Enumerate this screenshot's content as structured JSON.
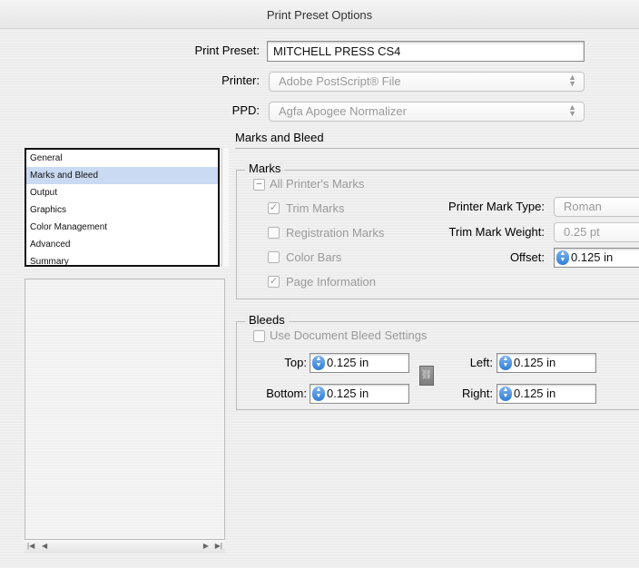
{
  "window": {
    "title": "Print Preset Options"
  },
  "form": {
    "print_preset_label": "Print Preset:",
    "print_preset_value": "MITCHELL PRESS CS4",
    "printer_label": "Printer:",
    "printer_value": "Adobe PostScript® File",
    "ppd_label": "PPD:",
    "ppd_value": "Agfa Apogee Normalizer"
  },
  "sidebar": {
    "items": [
      {
        "label": "General",
        "selected": false
      },
      {
        "label": "Marks and Bleed",
        "selected": true
      },
      {
        "label": "Output",
        "selected": false
      },
      {
        "label": "Graphics",
        "selected": false
      },
      {
        "label": "Color Management",
        "selected": false
      },
      {
        "label": "Advanced",
        "selected": false
      },
      {
        "label": "Summary",
        "selected": false
      }
    ]
  },
  "panel": {
    "title": "Marks and Bleed",
    "marks": {
      "group_title": "Marks",
      "all_marks_label": "All Printer's Marks",
      "all_marks_state": "mixed",
      "trim_marks_label": "Trim Marks",
      "trim_marks_checked": true,
      "registration_marks_label": "Registration Marks",
      "registration_marks_checked": false,
      "color_bars_label": "Color Bars",
      "color_bars_checked": false,
      "page_info_label": "Page Information",
      "page_info_checked": true,
      "mark_type_label": "Printer Mark Type:",
      "mark_type_value": "Roman",
      "trim_weight_label": "Trim Mark Weight:",
      "trim_weight_value": "0.25 pt",
      "offset_label": "Offset:",
      "offset_value": "0.125 in"
    },
    "bleeds": {
      "group_title": "Bleeds",
      "use_doc_label": "Use Document Bleed Settings",
      "use_doc_checked": false,
      "top_label": "Top:",
      "top_value": "0.125 in",
      "bottom_label": "Bottom:",
      "bottom_value": "0.125 in",
      "left_label": "Left:",
      "left_value": "0.125 in",
      "right_label": "Right:",
      "right_value": "0.125 in"
    }
  },
  "icons": {
    "popup_arrows": "updown-arrows-icon",
    "spin": "stepper-icon",
    "chain": "chain-link-icon",
    "checkmark": "checkmark-icon"
  },
  "colors": {
    "selection": "#c9daf2",
    "spinner": "#2f7ed8"
  }
}
